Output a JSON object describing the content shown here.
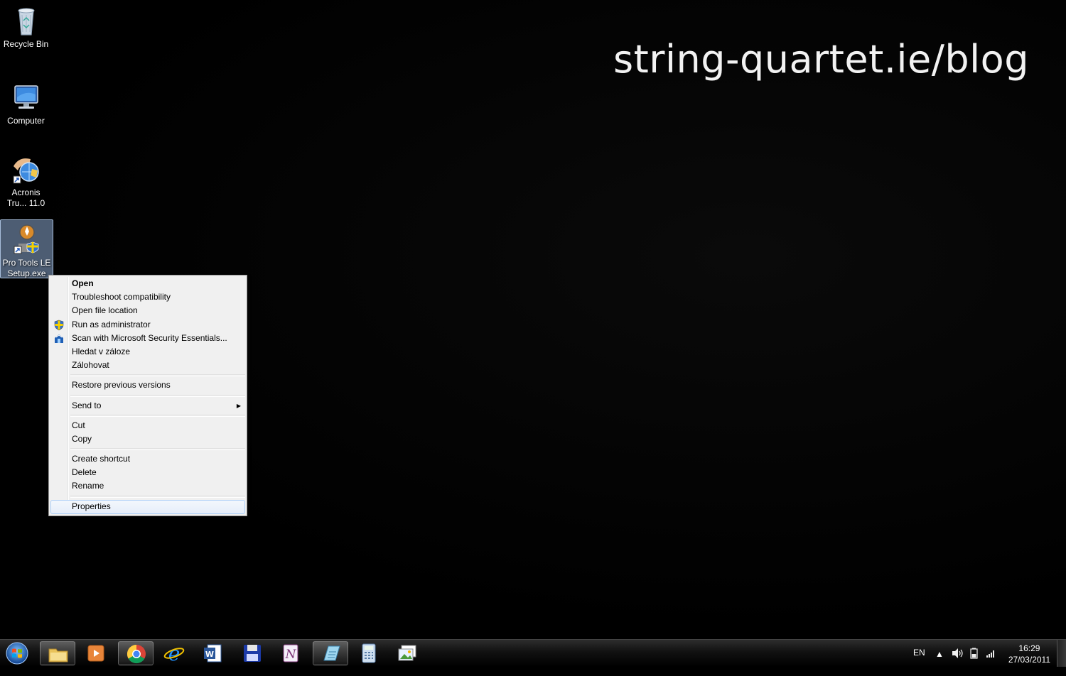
{
  "desktop": {
    "watermark": "string-quartet.ie/blog",
    "icons": [
      {
        "label": "Recycle Bin",
        "icon": "recycle-bin-icon"
      },
      {
        "label": "Computer",
        "icon": "computer-icon"
      },
      {
        "label": "Acronis Tru... 11.0",
        "icon": "acronis-icon"
      },
      {
        "label": "Pro Tools LE Setup.exe",
        "icon": "installer-icon"
      }
    ]
  },
  "context_menu": {
    "items": [
      {
        "label": "Open"
      },
      {
        "label": "Troubleshoot compatibility"
      },
      {
        "label": "Open file location"
      },
      {
        "label": "Run as administrator",
        "icon": "uac-shield-icon"
      },
      {
        "label": "Scan with Microsoft Security Essentials...",
        "icon": "mse-icon"
      },
      {
        "label": "Hledat v záloze"
      },
      {
        "label": "Zálohovat"
      },
      {
        "label": "Restore previous versions"
      },
      {
        "label": "Send to",
        "icon": "submenu-arrow-icon"
      },
      {
        "label": "Cut"
      },
      {
        "label": "Copy"
      },
      {
        "label": "Create shortcut"
      },
      {
        "label": "Delete"
      },
      {
        "label": "Rename"
      },
      {
        "label": "Properties"
      }
    ]
  },
  "taskbar": {
    "pinned": [
      {
        "name": "windows-explorer-icon"
      },
      {
        "name": "media-player-icon"
      },
      {
        "name": "chrome-icon"
      },
      {
        "name": "internet-explorer-icon"
      },
      {
        "name": "word-icon"
      },
      {
        "name": "save-disk-icon"
      },
      {
        "name": "onenote-icon"
      },
      {
        "name": "notepad-icon"
      },
      {
        "name": "calculator-icon"
      },
      {
        "name": "gallery-icon"
      }
    ],
    "language": "EN",
    "time": "16:29",
    "date": "27/03/2011"
  }
}
